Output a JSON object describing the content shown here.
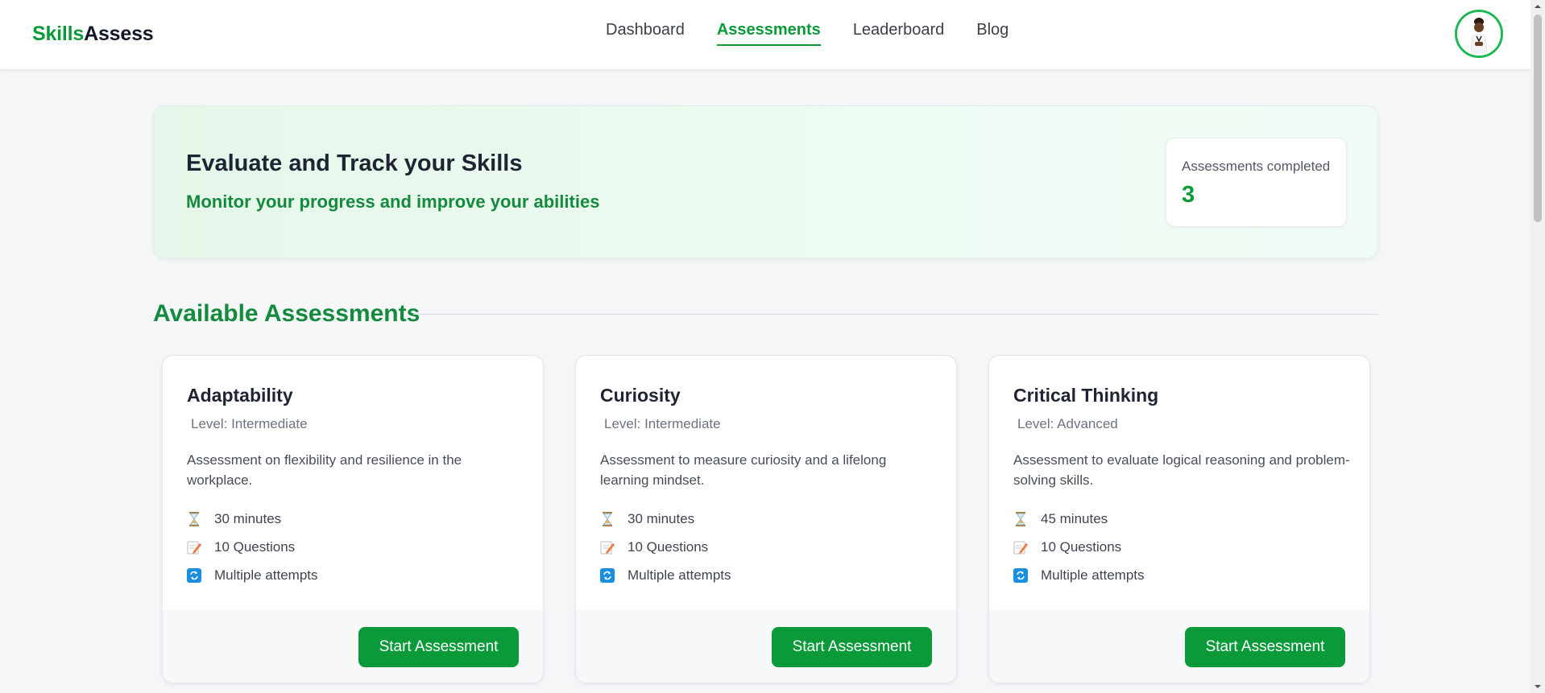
{
  "header": {
    "logo_part1": "Skills",
    "logo_part2": "Assess",
    "nav": [
      {
        "label": "Dashboard",
        "active": false
      },
      {
        "label": "Assessments",
        "active": true
      },
      {
        "label": "Leaderboard",
        "active": false
      },
      {
        "label": "Blog",
        "active": false
      }
    ],
    "avatar_icon": "user-avatar"
  },
  "hero": {
    "title": "Evaluate and Track your Skills",
    "subtitle": "Monitor your progress and improve your abilities",
    "stat_label": "Assessments completed",
    "stat_value": "3"
  },
  "section": {
    "title": "Available Assessments"
  },
  "cards": [
    {
      "title": "Adaptability",
      "level": "Level: Intermediate",
      "description": "Assessment on flexibility and resilience in the workplace.",
      "duration": "30 minutes",
      "questions": "10 Questions",
      "attempts": "Multiple attempts",
      "button": "Start Assessment"
    },
    {
      "title": "Curiosity",
      "level": "Level: Intermediate",
      "description": "Assessment to measure curiosity and a lifelong learning mindset.",
      "duration": "30 minutes",
      "questions": "10 Questions",
      "attempts": "Multiple attempts",
      "button": "Start Assessment"
    },
    {
      "title": "Critical Thinking",
      "level": "Level: Advanced",
      "description": "Assessment to evaluate logical reasoning and problem-solving skills.",
      "duration": "45 minutes",
      "questions": "10 Questions",
      "attempts": "Multiple attempts",
      "button": "Start Assessment"
    }
  ],
  "colors": {
    "brand": "#0a9a3a",
    "heading_green": "#138a3c",
    "hero_bg": "#e5f7ea",
    "page_bg": "#f5f6f8"
  },
  "icons": {
    "duration": "hourglass-icon",
    "questions": "memo-pencil-icon",
    "attempts": "repeat-icon"
  }
}
